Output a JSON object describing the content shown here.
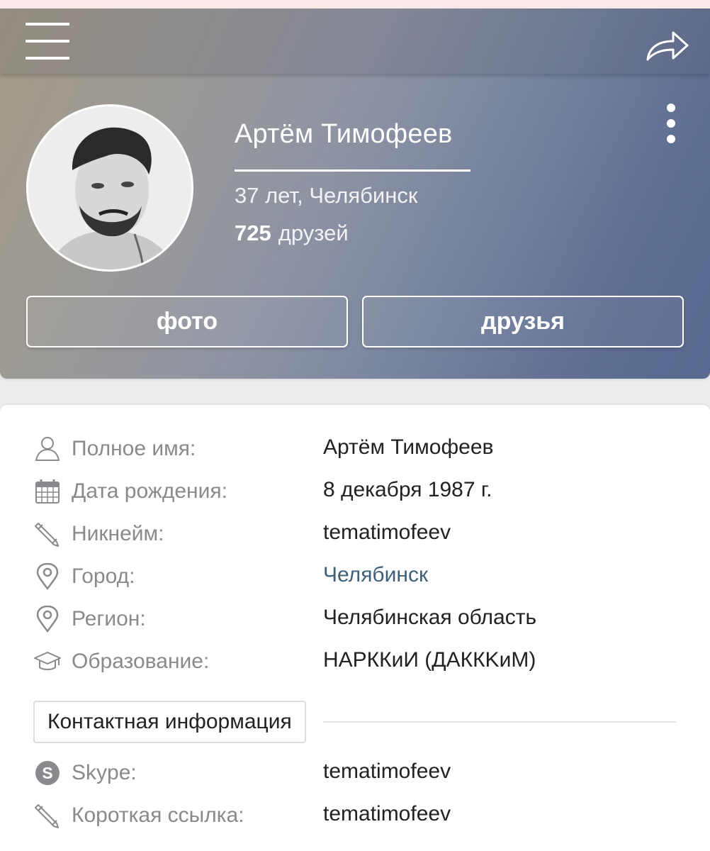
{
  "header": {
    "name": "Артём Тимофеев",
    "meta": "37 лет, Челябинск",
    "friends_count": "725",
    "friends_label": "друзей",
    "photo_button": "фото",
    "friends_button": "друзья"
  },
  "info": {
    "rows": [
      {
        "label": "Полное имя:",
        "value": "Артём Тимофеев",
        "icon": "user-icon"
      },
      {
        "label": "Дата рождения:",
        "value": "8 декабря 1987 г.",
        "icon": "calendar-icon"
      },
      {
        "label": "Никнейм:",
        "value": "tematimofeev",
        "icon": "pencil-icon"
      },
      {
        "label": "Город:",
        "value": "Челябинск",
        "icon": "location-pin-icon"
      },
      {
        "label": "Регион:",
        "value": "Челябинская область",
        "icon": "location-pin-icon"
      },
      {
        "label": "Образование:",
        "value": "НАРККиИ (ДАККKиМ)",
        "icon": "graduation-cap-icon"
      }
    ],
    "contact_section_title": "Контактная информация",
    "contact_rows": [
      {
        "label": "Skype:",
        "value": "tematimofeev",
        "icon": "skype-icon"
      },
      {
        "label": "Короткая ссылка:",
        "value": "tematimofeev",
        "icon": "pencil-icon"
      }
    ]
  },
  "colors": {
    "header_gradient_start": "#a49b88",
    "header_gradient_end": "#58688e",
    "link": "#3e6079",
    "label_gray": "#8a8a8e"
  }
}
